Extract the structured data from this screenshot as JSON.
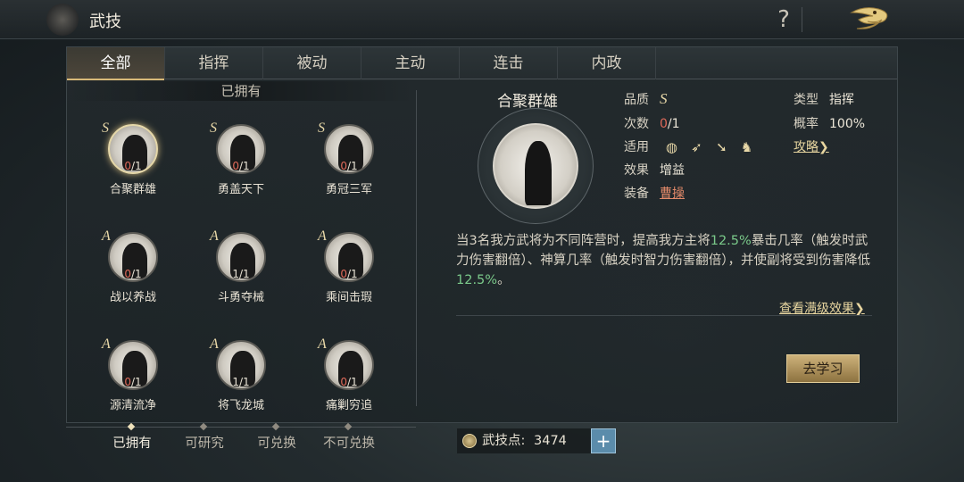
{
  "header": {
    "title": "武技",
    "help_glyph": "?"
  },
  "tabs": [
    {
      "label": "全部",
      "active": true
    },
    {
      "label": "指挥"
    },
    {
      "label": "被动"
    },
    {
      "label": "主动"
    },
    {
      "label": "连击"
    },
    {
      "label": "内政"
    }
  ],
  "owned_header": "已拥有",
  "skills": [
    {
      "name": "合聚群雄",
      "grade": "S",
      "used": "0",
      "total": "/1"
    },
    {
      "name": "勇盖天下",
      "grade": "S",
      "used": "0",
      "total": "/1"
    },
    {
      "name": "勇冠三军",
      "grade": "S",
      "used": "0",
      "total": "/1"
    },
    {
      "name": "战以养战",
      "grade": "A",
      "used": "0",
      "total": "/1"
    },
    {
      "name": "斗勇夺械",
      "grade": "A",
      "used": "1",
      "total": "/1"
    },
    {
      "name": "乘间击瑕",
      "grade": "A",
      "used": "0",
      "total": "/1"
    },
    {
      "name": "源清流净",
      "grade": "A",
      "used": "0",
      "total": "/1"
    },
    {
      "name": "将飞龙城",
      "grade": "A",
      "used": "1",
      "total": "/1"
    },
    {
      "name": "痛剿穷追",
      "grade": "A",
      "used": "0",
      "total": "/1"
    }
  ],
  "detail": {
    "name": "合聚群雄",
    "quality_label": "品质",
    "quality_value": "S",
    "count_label": "次数",
    "count_used": "0",
    "count_total": "/1",
    "apply_label": "适用",
    "apply_icons": [
      "shield-icon",
      "bow-icon",
      "spear-icon",
      "horse-icon"
    ],
    "effect_label": "效果",
    "effect_value": "增益",
    "equip_label": "装备",
    "equip_value": "曹操",
    "type_label": "类型",
    "type_value": "指挥",
    "rate_label": "概率",
    "rate_value": "100%",
    "guide_link": "攻略❯",
    "desc_part1": "当3名我方武将为不同阵营时，提高我方主将",
    "desc_hl1": "12.5%",
    "desc_part2": "暴击几率（触发时武力伤害翻倍）、神算几率（触发时智力伤害翻倍），并使副将受到伤害降低",
    "desc_hl2": "12.5%",
    "desc_part3": "。",
    "max_effect_link": "查看满级效果❯",
    "learn_button": "去学习"
  },
  "subtabs": [
    {
      "label": "已拥有",
      "active": true
    },
    {
      "label": "可研究"
    },
    {
      "label": "可兑换"
    },
    {
      "label": "不可兑换"
    }
  ],
  "points": {
    "label": "武技点:",
    "value": "3474",
    "plus": "+"
  },
  "colors": {
    "accent_gold": "#d8b978",
    "highlight_green": "#7ac98a",
    "count_red": "#e06a5a"
  }
}
